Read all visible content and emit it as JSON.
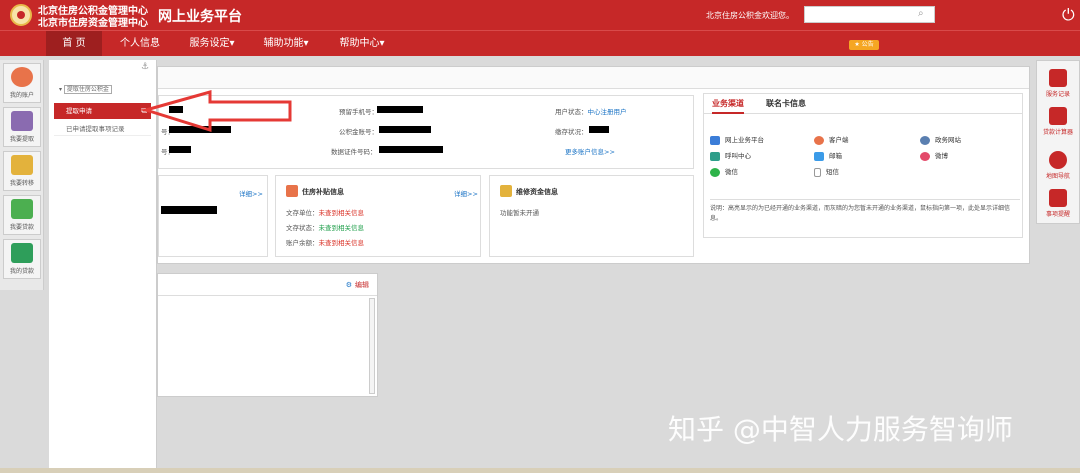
{
  "header": {
    "org_line1": "北京住房公积金管理中心",
    "org_line2": "北京市住房资金管理中心",
    "platform_title": "网上业务平台",
    "welcome": "北京住房公积金欢迎您。",
    "search_placeholder": ""
  },
  "nav": {
    "items": [
      "首 页",
      "个人信息",
      "服务设定▾",
      "辅助功能▾",
      "帮助中心▾"
    ],
    "badge": "★ 公告"
  },
  "left_bar": {
    "items": [
      "我的账户",
      "我要提取",
      "我要转移",
      "我要贷款",
      "我的贷款"
    ]
  },
  "dropdown": {
    "section": "提取住房公积金",
    "active_item": "提取申请",
    "item2": "已申请提取事项记录"
  },
  "account": {
    "phone_label": "预留手机号：",
    "status_label": "用户状态：",
    "status_value": "中心注册用户",
    "fund_label": "公积金账号：",
    "account_state_label": "缴存状况：",
    "id_label": "数据证件号码：",
    "label_a": "号：",
    "label_b": "号：",
    "more_link": "更多账户信息>>"
  },
  "cards": {
    "card1_more": "详细>>",
    "subsidy_title": "住房补贴信息",
    "subsidy_more": "详细>>",
    "subsidy_rows": [
      {
        "label": "文存单位：",
        "value": "未查到相关信息"
      },
      {
        "label": "文存状态：",
        "value": "未查到相关信息"
      },
      {
        "label": "账户余额：",
        "value": "未查到相关信息"
      }
    ],
    "repair_title": "维修资金信息",
    "repair_note": "功能暂未开通"
  },
  "biz": {
    "tab1": "业务渠道",
    "tab2": "联名卡信息",
    "channels": [
      "网上业务平台",
      "客户端",
      "政务网站",
      "呼叫中心",
      "邮箱",
      "微博",
      "微信",
      "短信"
    ],
    "note": "说明：高亮显示的为已经开通的业务渠道，而灰暗的为您暂未开通的业务渠道，鼠标指向第一项，此处显示详细信息。"
  },
  "panel2": {
    "edit_label": "编辑"
  },
  "right_bar": {
    "items": [
      "服务记录",
      "贷款计算器",
      "地图导航",
      "事项提醒"
    ]
  },
  "watermark": "知乎 @中智人力服务智询师",
  "colors": {
    "brand_red": "#c62828",
    "link_blue": "#1a73c5"
  }
}
